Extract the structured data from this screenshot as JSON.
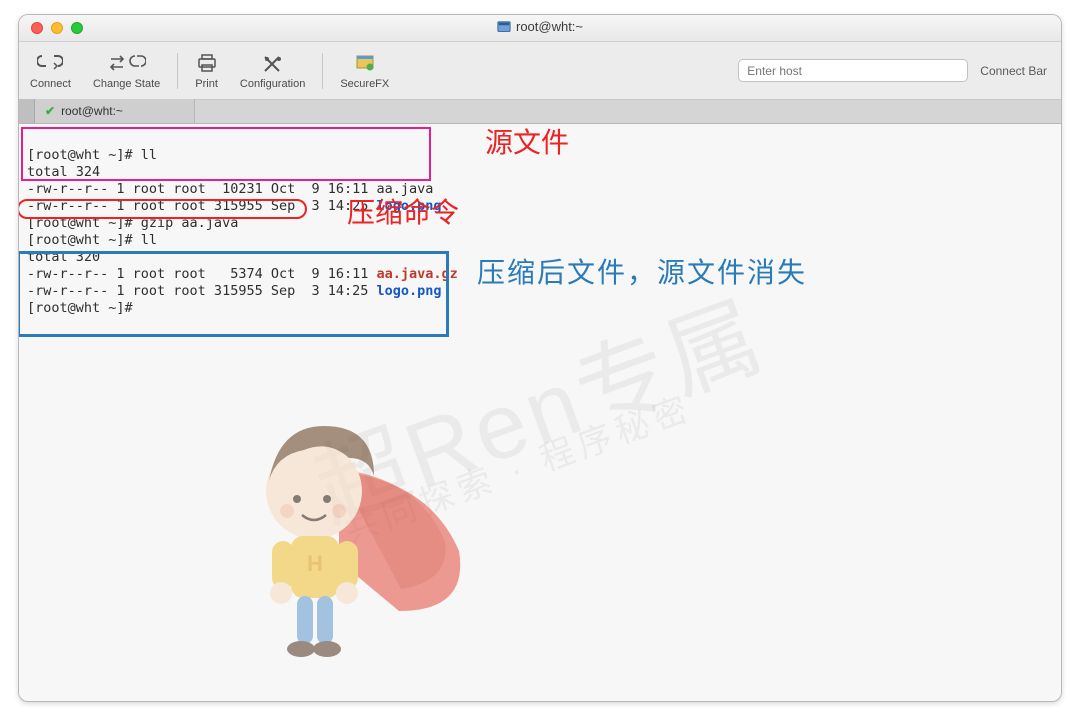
{
  "window": {
    "title": "root@wht:~"
  },
  "toolbar": {
    "connect": "Connect",
    "change_state": "Change State",
    "print": "Print",
    "configuration": "Configuration",
    "securefx": "SecureFX",
    "host_placeholder": "Enter host",
    "connect_bar": "Connect Bar"
  },
  "tab": {
    "label": "root@wht:~"
  },
  "annotations": {
    "src": "源文件",
    "cmd": "压缩命令",
    "after": "压缩后文件，源文件消失"
  },
  "terminal": {
    "l1": "[root@wht ~]# ll",
    "l2": "total 324",
    "l3": "-rw-r--r-- 1 root root  10231 Oct  9 16:11 aa.java",
    "l4a": "-rw-r--r-- 1 root root 315955 Sep  3 14:25 ",
    "l4b": "logo.png",
    "l5": "[root@wht ~]# gzip aa.java",
    "l6": "[root@wht ~]# ll",
    "l7": "total 320",
    "l8a": "-rw-r--r-- 1 root root   5374 Oct  9 16:11 ",
    "l8b": "aa.java.gz",
    "l9a": "-rw-r--r-- 1 root root 315955 Sep  3 14:25 ",
    "l9b": "logo.png",
    "l10": "[root@wht ~]# "
  },
  "watermark": {
    "main": "超Ren专属",
    "sub": "共同探索 · 程序秘密"
  }
}
